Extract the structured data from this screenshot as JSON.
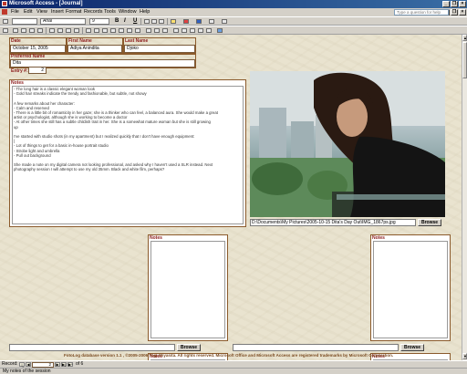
{
  "window": {
    "title": "Microsoft Access - [Journal]",
    "minimize": "_",
    "restore": "❐",
    "close": "×"
  },
  "menubar": {
    "items": [
      "File",
      "Edit",
      "View",
      "Insert",
      "Format",
      "Records",
      "Tools",
      "Window",
      "Help"
    ],
    "help_placeholder": "Type a question for help",
    "window_controls": [
      "_",
      "❐",
      "×"
    ]
  },
  "format_toolbar": {
    "font": "Arial",
    "size": "9",
    "bold": "B",
    "italic": "I",
    "underline": "U"
  },
  "record": {
    "date_label": "Date",
    "date_value": "October 15, 2005",
    "first_name_label": "First Name",
    "first_name_value": "Adiya Anindita",
    "last_name_label": "Last Name",
    "last_name_value": "Djoko",
    "preferred_name_label": "Preferred Name",
    "preferred_name_value": "Dita",
    "entry_label": "Entry #:",
    "entry_value": "2",
    "notes_label": "Notes",
    "notes_lines": [
      "- The long hair is a classic elegant woman look",
      "- Gold hair streaks indicate the trendy and fashionable, but subtle, not showy",
      "",
      "A few remarks about her character:",
      "- Calm and reserved",
      "- There is a little bit of romanticity in her gaze; she is a thinker who can feel, a balanced aura. She would make a great",
      "artist or psychologist, although she is working to become a doctor",
      "- At other times she still has a subtle childish trait in her. She is a somewhat mature woman but she is still growing",
      "up",
      "",
      "I've started with studio shots (in my apartment) but I realized quickly that I don't have enough equipment:",
      "|",
      "- Lot of things to get for a basic in-house portrait studio",
      "- Strobe light and umbrella",
      "- Pull out background",
      "",
      "She made a note on my digital camera not looking professional, and asked why I haven't used a SLR instead. Next",
      "photography session I will attempt to use my old 35mm. Black and white film, perhaps?"
    ],
    "photo_path": "D:\\Documents\\My Pictures\\2005-10-15 Dita's Day Out\\IMG_1867ps.jpg",
    "browse_label": "Browse"
  },
  "empty_panels": {
    "notes_label": "Notes",
    "browse_label": "Browse"
  },
  "footer_text": "FotoLog database version 1.1 , ©2005-2006 Yogi Wiyasita. All rights reserved. Microsoft Office and Microsoft Access are registered trademarks by Microsoft Corporation.",
  "record_nav": {
    "label": "Record:",
    "current": "2",
    "of_text": "of 6"
  },
  "status_text": "My notes of the session"
}
